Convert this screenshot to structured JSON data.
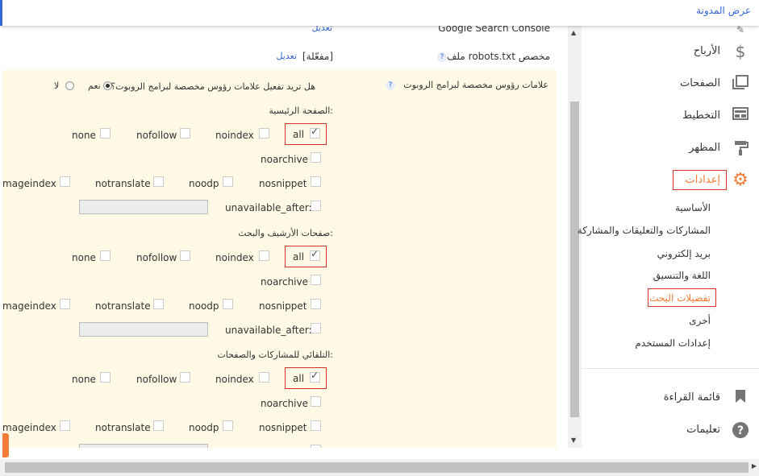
{
  "topbar": {
    "view_blog": "عرض المدونة"
  },
  "main": {
    "search_console": {
      "label": "Google Search Console",
      "action": "تعديل"
    },
    "robots_txt": {
      "label": "ملف robots.txt مخصص",
      "status": "[مفعّلة]",
      "action": "تعديل"
    },
    "robot_headers": {
      "label": "علامات رؤوس مخصصة لبرامج الروبوت",
      "question": "هل تريد تفعيل علامات رؤوس مخصصة لبرامج الروبوت؟",
      "yes": "نعم",
      "no": "لا",
      "selected": "yes"
    },
    "sections": [
      {
        "title": "الصفحة الرئيسية:"
      },
      {
        "title": "صفحات الأرشيف والبحث:"
      },
      {
        "title": "التلقائي للمشاركات والصفحات:"
      }
    ],
    "tags": {
      "all": "all",
      "noindex": "noindex",
      "nofollow": "nofollow",
      "none": "none",
      "noarchive": "noarchive",
      "nosnippet": "nosnippet",
      "noodp": "noodp",
      "notranslate": "notranslate",
      "noimageindex": "mageindex",
      "unavailable_after": "unavailable_after:"
    }
  },
  "sidebar": {
    "nav": [
      {
        "label": "الأرباح",
        "icon": "dollar-icon"
      },
      {
        "label": "الصفحات",
        "icon": "pages-icon"
      },
      {
        "label": "التخطيط",
        "icon": "layout-icon"
      },
      {
        "label": "المظهر",
        "icon": "paint-roller-icon"
      },
      {
        "label": "إعدادات",
        "icon": "gear-icon"
      }
    ],
    "settings_sub": [
      "الأساسية",
      "المشاركات والتعليقات والمشاركة",
      "بريد إلكتروني",
      "اللغة والتنسيق",
      "تفضيلات البحث",
      "أخرى",
      "إعدادات المستخدم"
    ],
    "reading_list": "قائمة القراءة",
    "help": "تعليمات"
  },
  "colors": {
    "accent": "#3367d6",
    "active": "#f57c36",
    "highlight": "#d93025",
    "panel_bg": "#fff9e5"
  }
}
